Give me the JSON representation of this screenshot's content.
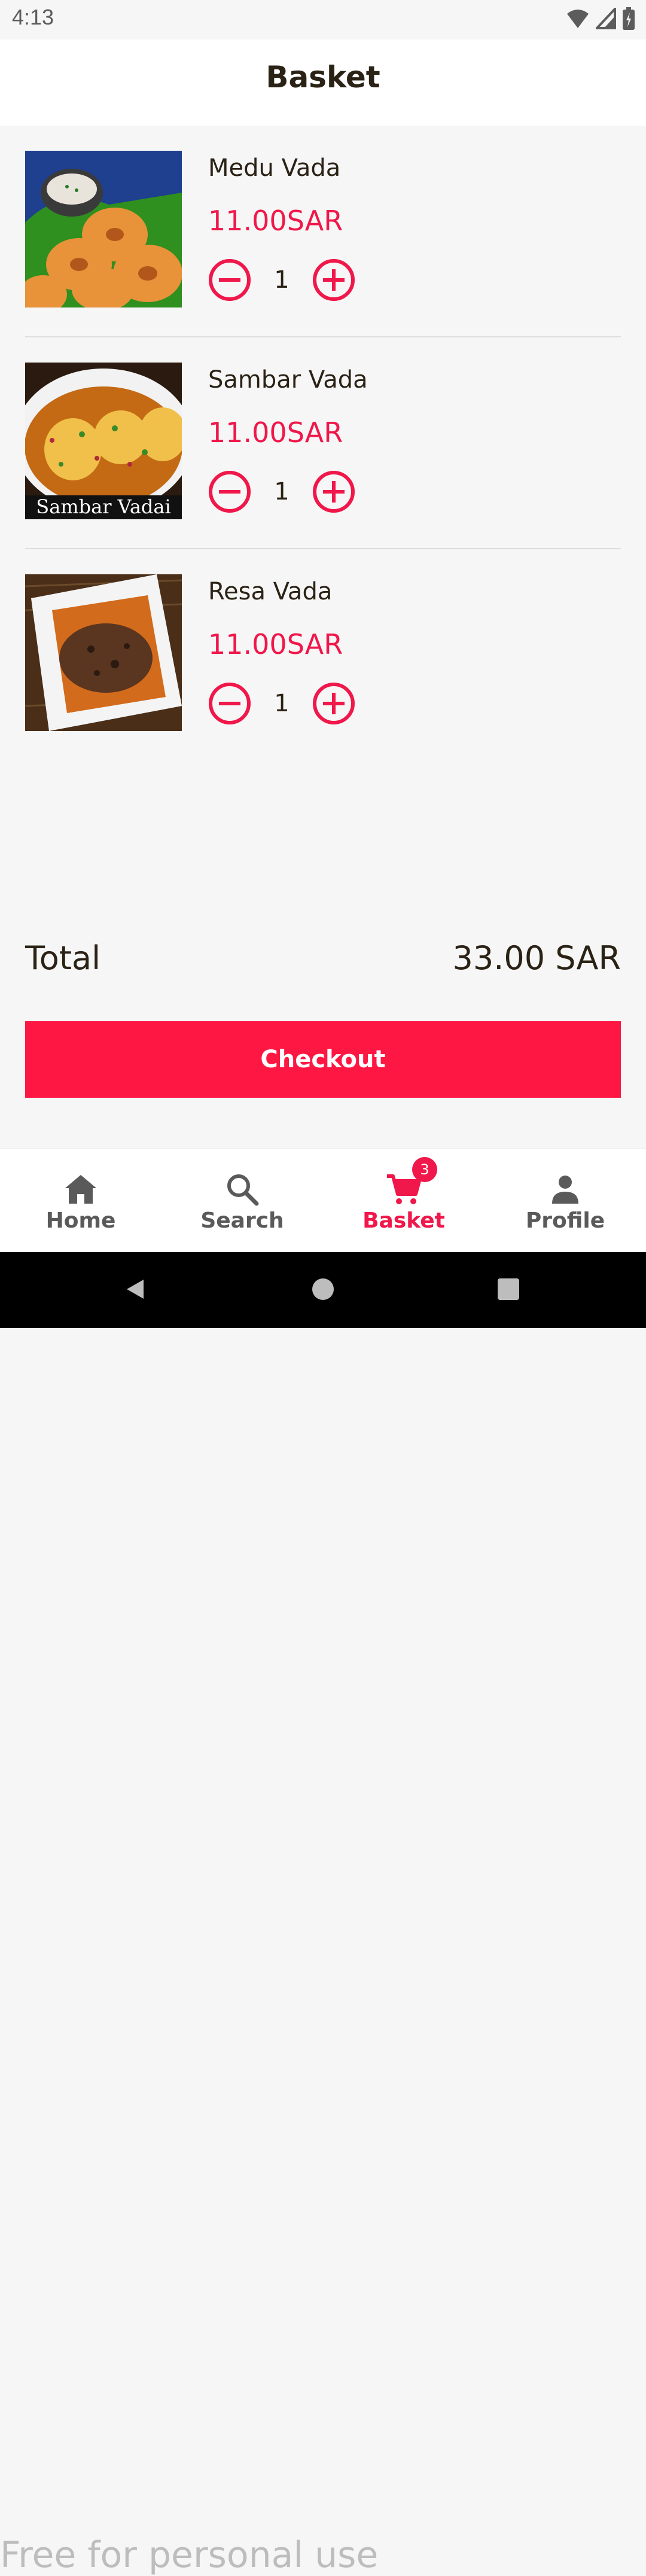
{
  "status_bar": {
    "time": "4:13"
  },
  "header": {
    "title": "Basket"
  },
  "items": [
    {
      "name": "Medu Vada",
      "price": "11.00SAR",
      "quantity": "1",
      "image_caption": ""
    },
    {
      "name": "Sambar Vada",
      "price": "11.00SAR",
      "quantity": "1",
      "image_caption": "Sambar Vadai"
    },
    {
      "name": "Resa Vada",
      "price": "11.00SAR",
      "quantity": "1",
      "image_caption": ""
    }
  ],
  "total": {
    "label": "Total",
    "value": "33.00 SAR"
  },
  "checkout": {
    "label": "Checkout"
  },
  "bottom_nav": {
    "items": [
      {
        "label": "Home",
        "icon": "home-icon"
      },
      {
        "label": "Search",
        "icon": "search-icon"
      },
      {
        "label": "Basket",
        "icon": "cart-icon",
        "badge": "3",
        "active": true
      },
      {
        "label": "Profile",
        "icon": "person-icon"
      }
    ]
  },
  "watermark": "Free for personal use",
  "colors": {
    "accent": "#ff1744",
    "price": "#f0174a",
    "text": "#2b2216"
  }
}
